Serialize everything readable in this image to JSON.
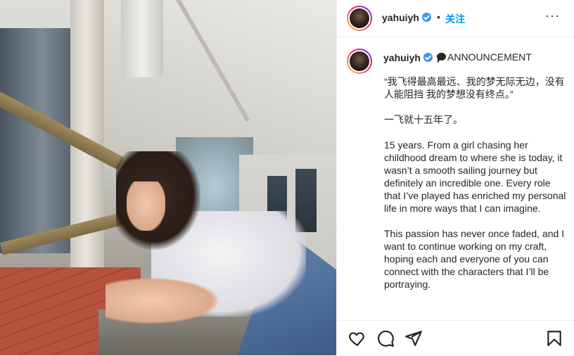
{
  "post": {
    "username": "yahuiyh",
    "follow_label": "关注",
    "separator": "•",
    "more_label": "···"
  },
  "caption": {
    "username": "yahuiyh",
    "announcement": "ANNOUNCEMENT",
    "paragraphs": [
      "“我飞得最高最远、我的梦无际无边，没有人能阻挡 我的梦想没有终点。”",
      "一飞就十五年了。",
      "15 years. From a girl chasing her childhood dream to where she is today, it wasn’t a smooth sailing journey but definitely an incredible one. Every role that I’ve played has enriched my personal life in more ways that I can imagine.",
      "This passion has never once faded, and I want to continue working on my craft, hoping each and everyone of you can connect with the characters that I’ll be portraying."
    ]
  },
  "icons": {
    "verified": "verified-badge-icon",
    "speech": "speech-bubble-icon",
    "like": "heart-icon",
    "comment": "comment-icon",
    "share": "paper-plane-icon",
    "save": "bookmark-icon"
  },
  "colors": {
    "follow": "#0095f6",
    "verified": "#3897f0",
    "text": "#262626"
  }
}
